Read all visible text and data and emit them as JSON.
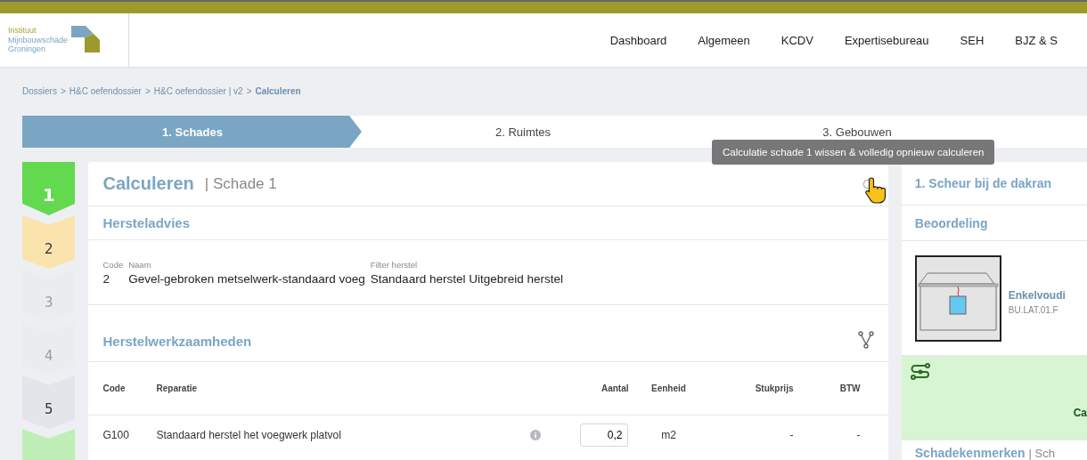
{
  "logo": {
    "lines": [
      "Instituut",
      "Mijnbouwschade",
      "Groningen"
    ]
  },
  "nav": [
    {
      "label": "Dashboard"
    },
    {
      "label": "Algemeen"
    },
    {
      "label": "KCDV"
    },
    {
      "label": "Expertisebureau"
    },
    {
      "label": "SEH"
    },
    {
      "label": "BJZ & S"
    }
  ],
  "breadcrumb": [
    {
      "label": "Dossiers",
      "current": false
    },
    {
      "label": "H&C oefendossier",
      "current": false
    },
    {
      "label": "H&C oefendossier | v2",
      "current": false
    },
    {
      "label": "Calculeren",
      "current": true
    }
  ],
  "breadcrumb_separator": ">",
  "wizard_steps": [
    {
      "label": "1. Schades",
      "selected": true
    },
    {
      "label": "2. Ruimtes",
      "selected": false
    },
    {
      "label": "3. Gebouwen",
      "selected": false
    },
    {
      "selected": false
    }
  ],
  "damage_steps": [
    {
      "label": "1",
      "kind": "active"
    },
    {
      "label": "2",
      "kind": "warning"
    },
    {
      "label": "3",
      "kind": "disabled"
    },
    {
      "label": "4",
      "kind": "disabled"
    },
    {
      "label": "5",
      "kind": "neutral"
    },
    {
      "kind": "done"
    }
  ],
  "card": {
    "title": "Calculeren",
    "subtitle": "| Schade 1",
    "advice": {
      "heading": "Hersteladvies",
      "fields": [
        {
          "label": "Code",
          "value": "2"
        },
        {
          "label": "Naam",
          "value": "Gevel-gebroken metselwerk-standaard voeg"
        },
        {
          "label": "Filter herstel",
          "value": "Standaard herstel Uitgebreid herstel"
        }
      ]
    },
    "works": {
      "heading": "Herstelwerkzaamheden",
      "columns": [
        "Code",
        "Reparatie",
        "Aantal",
        "Eenheid",
        "Stukprijs",
        "BTW"
      ],
      "rows": [
        {
          "code": "G100",
          "repair": "Standaard herstel het voegwerk platvol",
          "quantity": "0,2",
          "unit": "m2",
          "unit_price": "-",
          "vat": "-"
        }
      ]
    }
  },
  "tooltip": "Calculatie schade 1 wissen & volledig opnieuw calculeren",
  "side": {
    "title": "1. Scheur bij de dakran",
    "assessment": "Beoordeling",
    "item_title": "Enkelvoudi",
    "item_code": "BU.LAT.01.F",
    "green_text": "Ca",
    "next_title": "Schadekenmerken",
    "next_subtitle": "| Sch"
  }
}
